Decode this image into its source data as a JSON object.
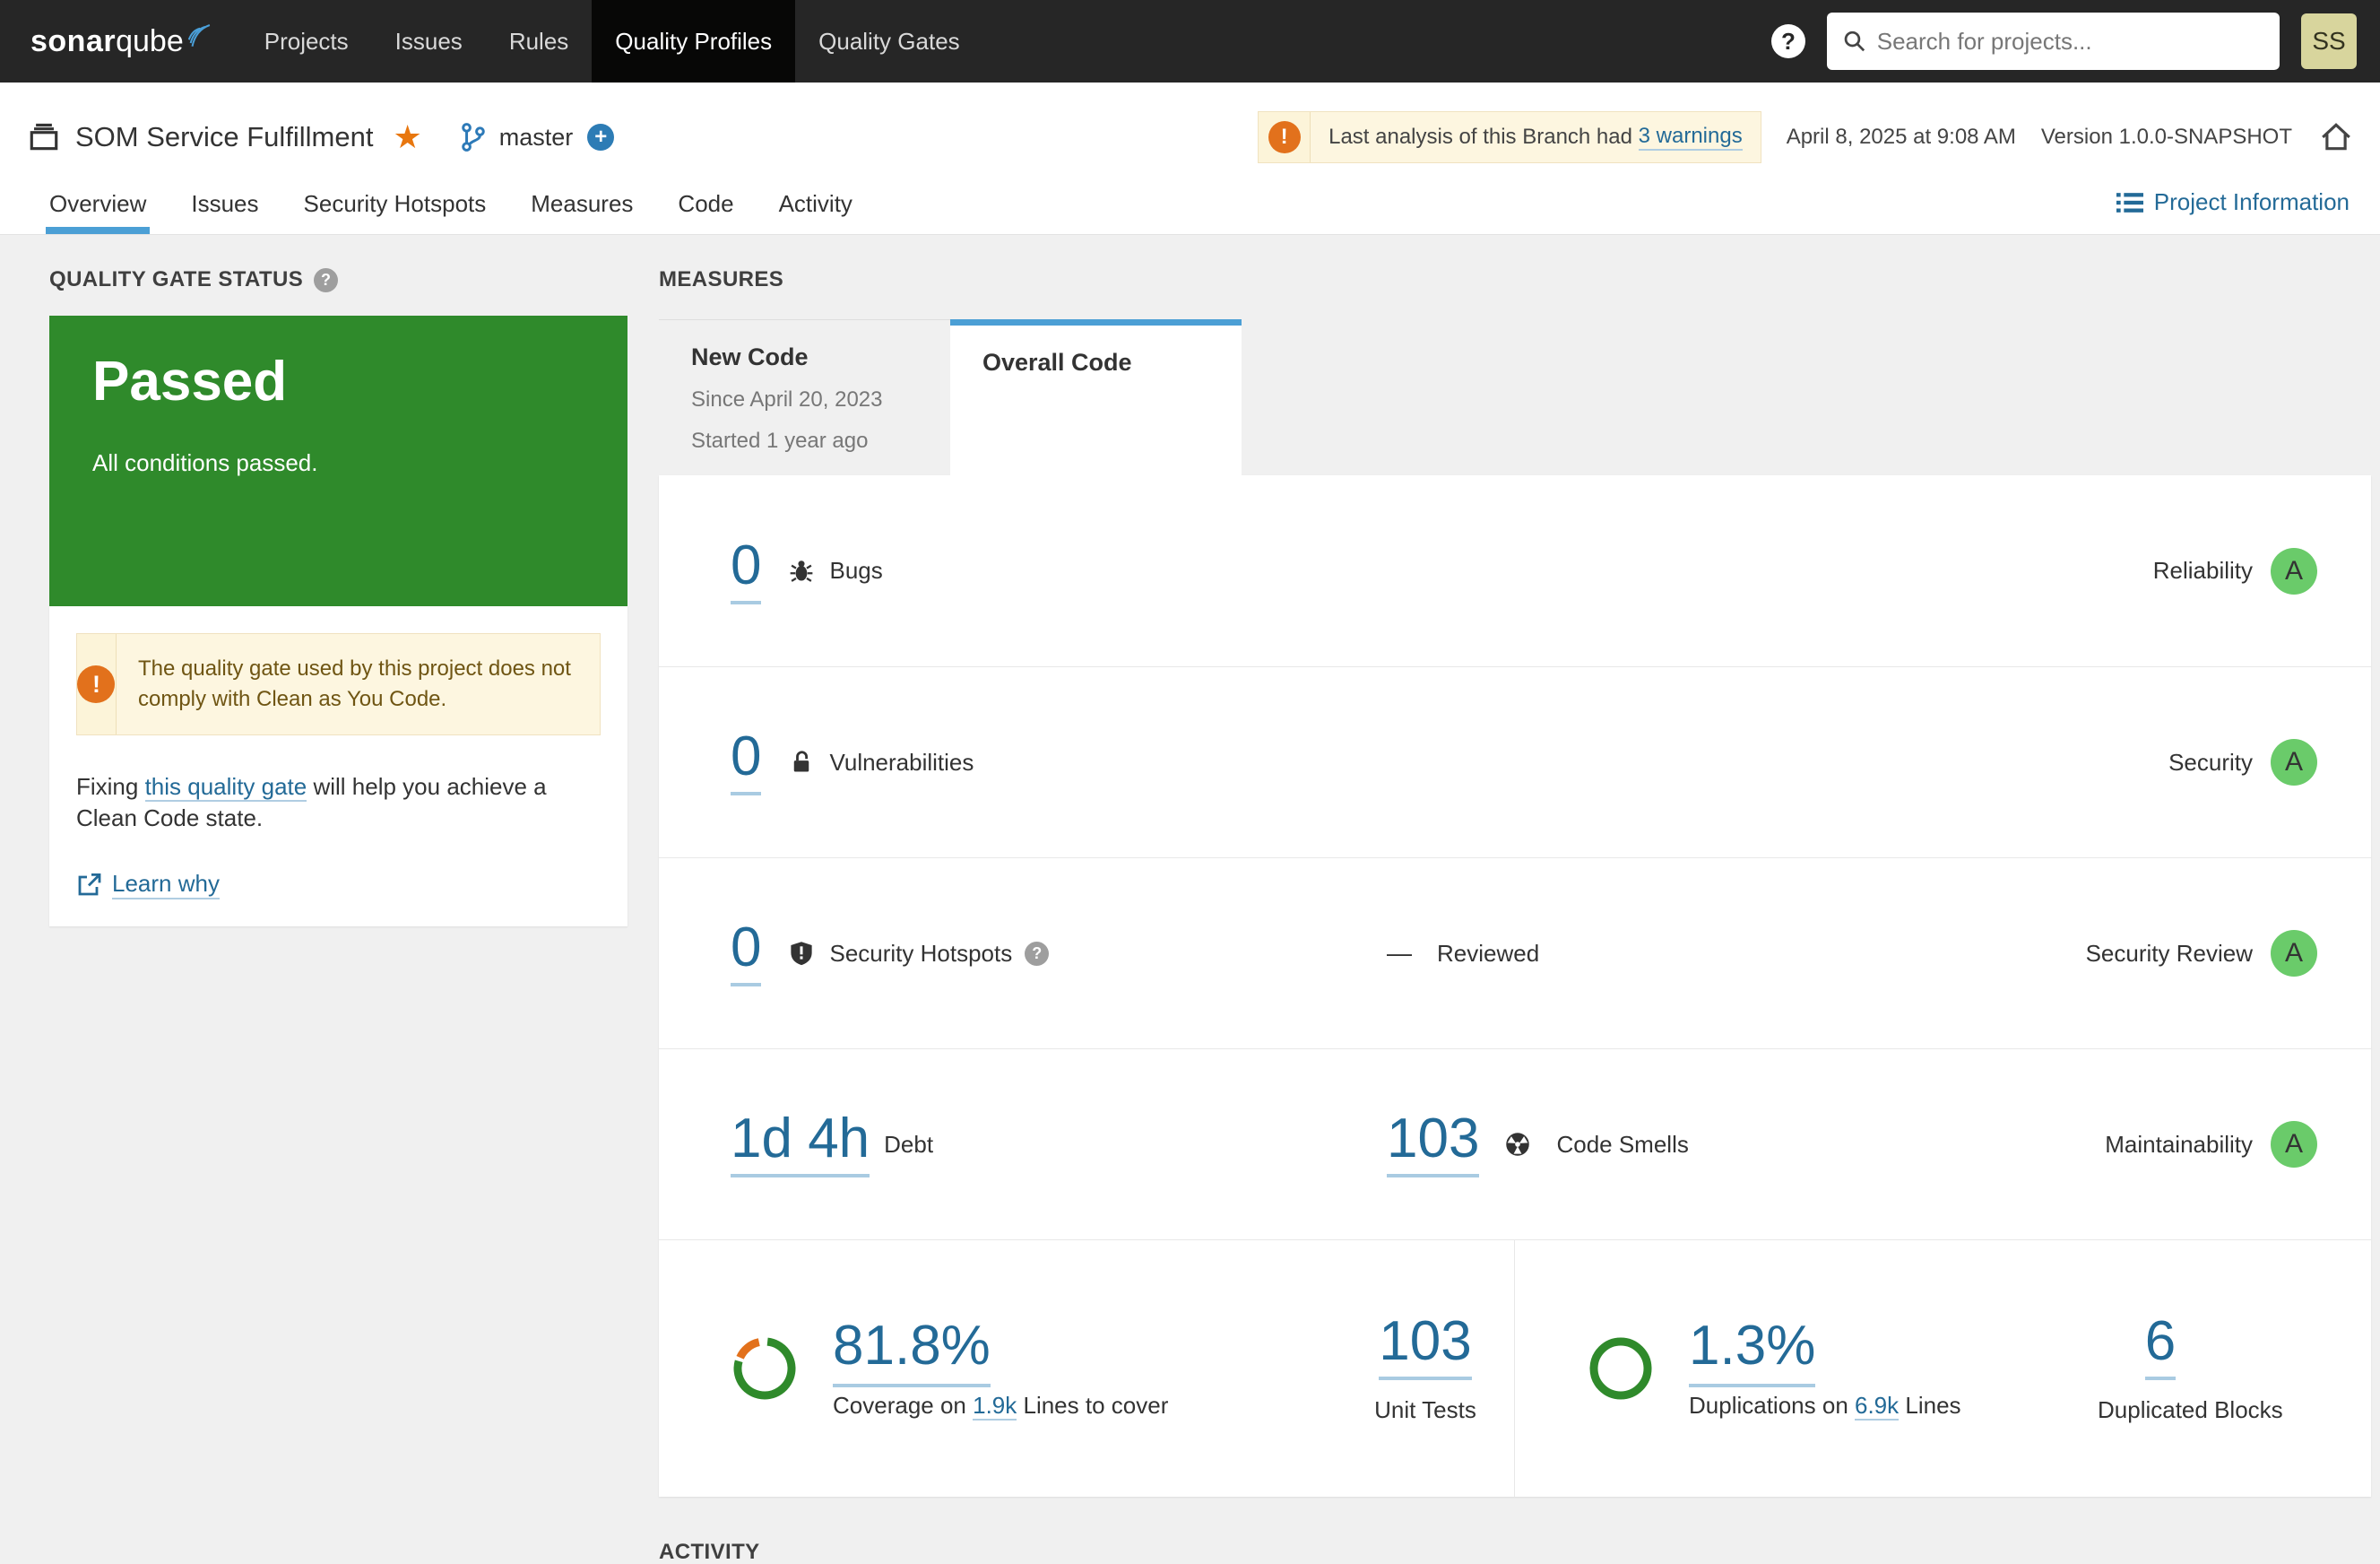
{
  "colors": {
    "navbar_bg": "#262626",
    "navbar_active_bg": "#070706",
    "accent_blue": "#236a97",
    "tab_underline_blue": "#4b9fd5",
    "passed_green": "#2f8a2b",
    "rating_green": "#6acb6a",
    "warning_orange": "#e2711c",
    "star_orange": "#e8770f",
    "warn_box_bg": "#fdf6e0",
    "warn_box_border": "#f0e2c0",
    "avatar_bg": "#d8d59d"
  },
  "navbar": {
    "brand_bold": "sonar",
    "brand_light": "qube",
    "items": [
      {
        "label": "Projects"
      },
      {
        "label": "Issues"
      },
      {
        "label": "Rules"
      },
      {
        "label": "Quality Profiles"
      },
      {
        "label": "Quality Gates"
      }
    ],
    "active_item": "Quality Profiles",
    "help_glyph": "?",
    "search_placeholder": "Search for projects...",
    "avatar_initials": "SS"
  },
  "header": {
    "project_name": "SOM Service Fulfillment",
    "branch_name": "master",
    "analysis_warning_text": "Last analysis of this Branch had",
    "analysis_warning_link": "3 warnings",
    "analysis_date": "April 8, 2025 at 9:08 AM",
    "version": "Version 1.0.0-SNAPSHOT",
    "tabs": [
      {
        "label": "Overview"
      },
      {
        "label": "Issues"
      },
      {
        "label": "Security Hotspots"
      },
      {
        "label": "Measures"
      },
      {
        "label": "Code"
      },
      {
        "label": "Activity"
      }
    ],
    "active_tab": "Overview",
    "project_information": "Project Information"
  },
  "quality_gate": {
    "section_title": "QUALITY GATE STATUS",
    "help_glyph": "?",
    "status": "Passed",
    "subtitle": "All conditions passed.",
    "note": "The quality gate used by this project does not comply with Clean as You Code.",
    "fix_prefix": "Fixing ",
    "fix_link": "this quality gate",
    "fix_suffix": " will help you achieve a Clean Code state.",
    "learn_why": "Learn why"
  },
  "measures": {
    "section_title": "MEASURES",
    "tabs": {
      "new_code": {
        "label": "New Code",
        "line1": "Since April 20, 2023",
        "line2": "Started 1 year ago"
      },
      "overall_code": {
        "label": "Overall Code"
      }
    },
    "active_tab": "Overall Code",
    "rows": {
      "bugs": {
        "value": "0",
        "label": "Bugs",
        "rating_label": "Reliability",
        "rating": "A"
      },
      "vulnerabilities": {
        "value": "0",
        "label": "Vulnerabilities",
        "rating_label": "Security",
        "rating": "A"
      },
      "hotspots": {
        "value": "0",
        "label": "Security Hotspots",
        "help_glyph": "?",
        "reviewed_value": "—",
        "reviewed_label": "Reviewed",
        "rating_label": "Security Review",
        "rating": "A"
      },
      "debt": {
        "value": "1d 4h",
        "label": "Debt"
      },
      "code_smells": {
        "value": "103",
        "label": "Code Smells",
        "rating_label": "Maintainability",
        "rating": "A"
      }
    },
    "coverage": {
      "value": "81.8%",
      "percent": 81.8,
      "caption_prefix": "Coverage on ",
      "lines_link": "1.9k",
      "caption_suffix": " Lines to cover",
      "unit_tests_value": "103",
      "unit_tests_label": "Unit Tests"
    },
    "duplications": {
      "value": "1.3%",
      "percent": 1.3,
      "caption_prefix": "Duplications on ",
      "lines_link": "6.9k",
      "caption_suffix": " Lines",
      "blocks_value": "6",
      "blocks_label": "Duplicated Blocks"
    }
  },
  "activity": {
    "section_title": "ACTIVITY"
  }
}
